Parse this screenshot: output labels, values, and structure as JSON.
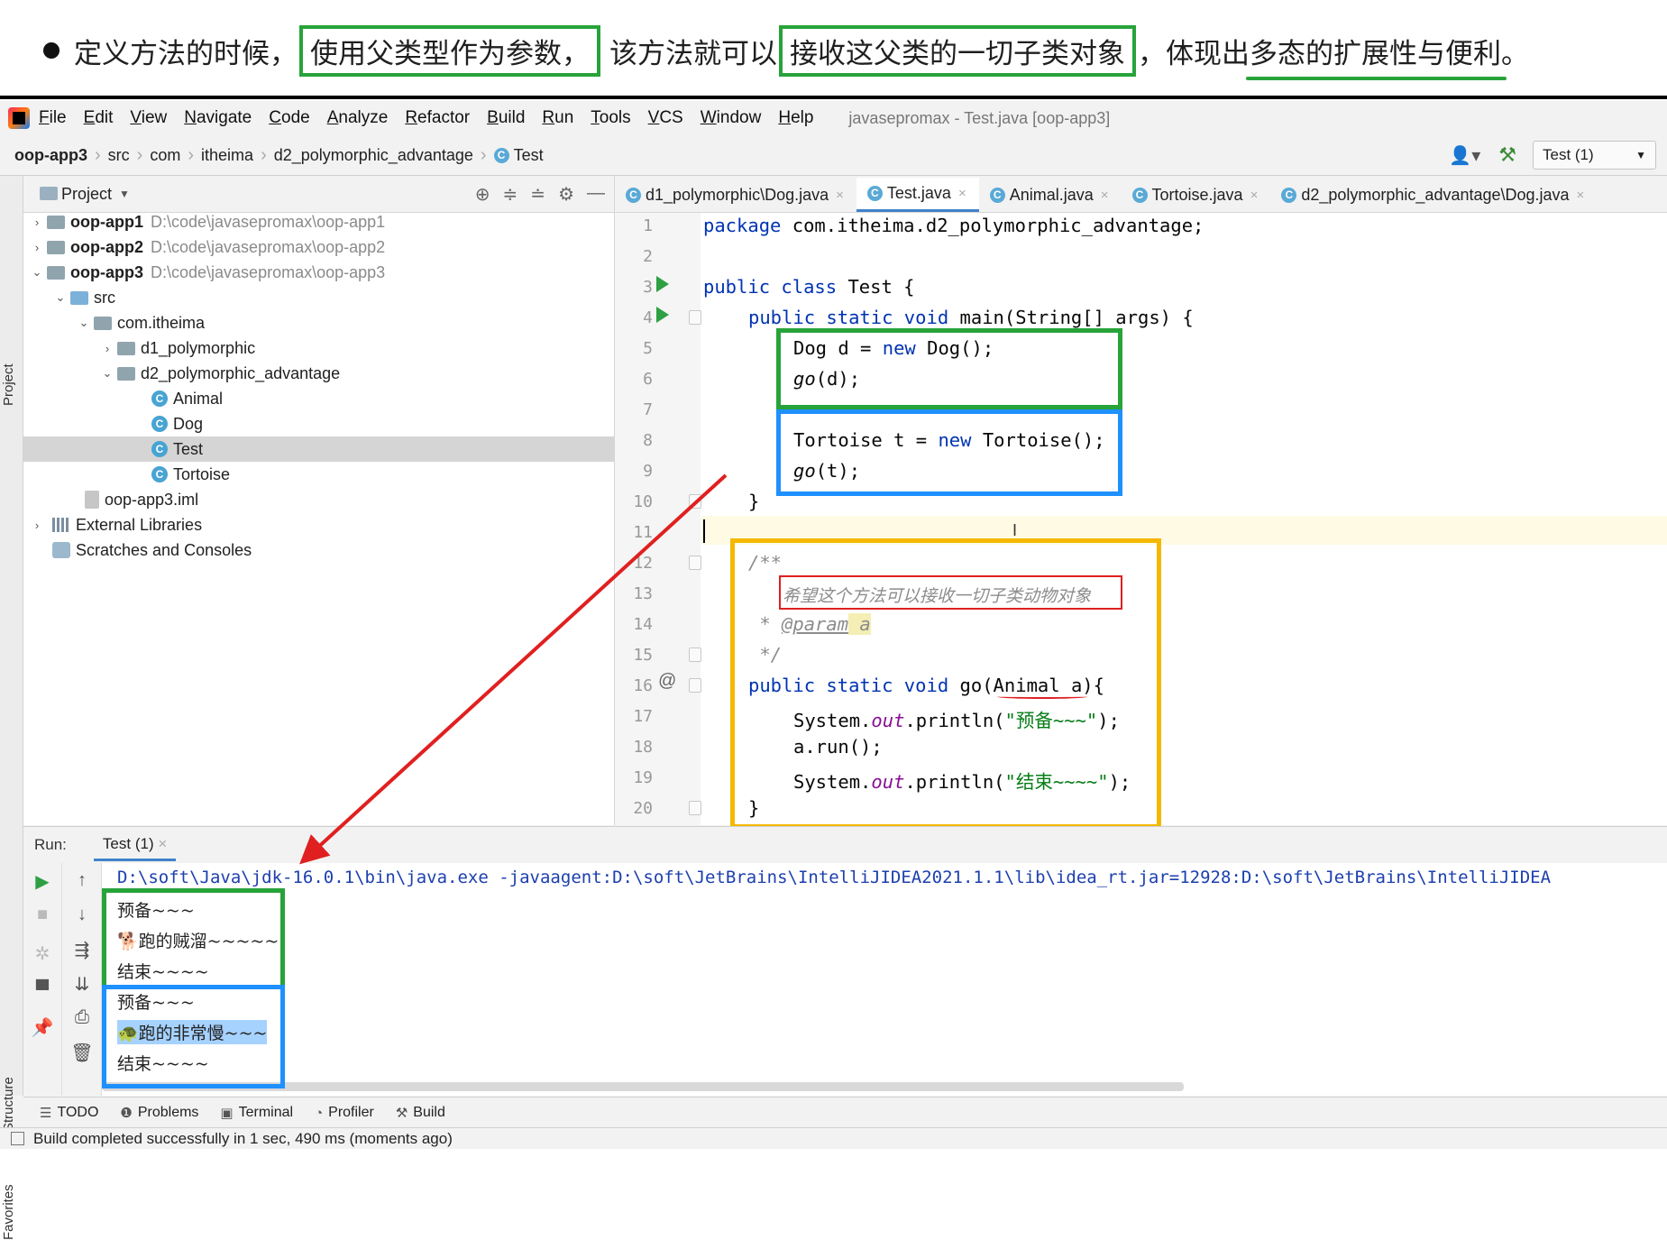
{
  "slide": {
    "heading_parts": [
      "定义方法的时候，",
      "使用父类型作为参数，",
      "该方法就可以",
      "接收这父类的一切子类对象",
      "，体现出",
      "多态的扩展性与便利",
      "。"
    ]
  },
  "menubar": {
    "items": [
      "File",
      "Edit",
      "View",
      "Navigate",
      "Code",
      "Analyze",
      "Refactor",
      "Build",
      "Run",
      "Tools",
      "VCS",
      "Window",
      "Help"
    ],
    "window_title": "javasepromax - Test.java [oop-app3]"
  },
  "navbar": {
    "breadcrumbs": [
      "oop-app3",
      "src",
      "com",
      "itheima",
      "d2_polymorphic_advantage",
      "Test"
    ],
    "run_config": "Test (1)"
  },
  "left_stripe": {
    "project_label": "Project",
    "structure_label": "Structure",
    "favorites_label": "Favorites"
  },
  "project_panel": {
    "title": "Project",
    "tree": [
      {
        "label": "oop-app1",
        "path": "D:\\code\\javasepromax\\oop-app1"
      },
      {
        "label": "oop-app2",
        "path": "D:\\code\\javasepromax\\oop-app2"
      },
      {
        "label": "oop-app3",
        "path": "D:\\code\\javasepromax\\oop-app3"
      },
      {
        "label": "src"
      },
      {
        "label": "com.itheima"
      },
      {
        "label": "d1_polymorphic"
      },
      {
        "label": "d2_polymorphic_advantage"
      },
      {
        "label": "Animal"
      },
      {
        "label": "Dog"
      },
      {
        "label": "Test"
      },
      {
        "label": "Tortoise"
      },
      {
        "label": "oop-app3.iml"
      },
      {
        "label": "External Libraries"
      },
      {
        "label": "Scratches and Consoles"
      }
    ]
  },
  "editor_tabs": [
    "d1_polymorphic\\Dog.java",
    "Test.java",
    "Animal.java",
    "Tortoise.java",
    "d2_polymorphic_advantage\\Dog.java"
  ],
  "code": {
    "line_numbers": [
      "1",
      "2",
      "3",
      "4",
      "5",
      "6",
      "7",
      "8",
      "9",
      "10",
      "11",
      "12",
      "13",
      "14",
      "15",
      "16",
      "17",
      "18",
      "19",
      "20"
    ],
    "l1_kw": "package",
    "l1_rest": " com.itheima.d2_polymorphic_advantage;",
    "l3_kw": "public class",
    "l3_rest": " Test {",
    "l4_kw": "public static void",
    "l4_rest": " main(String[] args) {",
    "l5_a": "Dog d = ",
    "l5_kw": "new",
    "l5_b": " Dog();",
    "l6_m": "go",
    "l6_b": "(d);",
    "l8_a": "Tortoise t = ",
    "l8_kw": "new",
    "l8_b": " Tortoise();",
    "l9_m": "go",
    "l9_b": "(t);",
    "l10": "}",
    "l12": "/**",
    "l13": "希望这个方法可以接收一切子类动物对象",
    "l14_a": " * ",
    "l14_tag": "@param",
    "l14_p": " a",
    "l15": " */",
    "l16_kw": "public static void",
    "l16_a": " go(",
    "l16_p": "Animal a",
    "l16_b": "){",
    "l17_a": "System.",
    "l17_f": "out",
    "l17_b": ".println(",
    "l17_s": "\"预备~~~\"",
    "l17_c": ");",
    "l18": "a.run();",
    "l19_a": "System.",
    "l19_f": "out",
    "l19_b": ".println(",
    "l19_s": "\"结束~~~~\"",
    "l19_c": ");",
    "l20": "}"
  },
  "run_panel": {
    "label": "Run:",
    "tab": "Test (1)",
    "command": "D:\\soft\\Java\\jdk-16.0.1\\bin\\java.exe -javaagent:D:\\soft\\JetBrains\\IntelliJIDEA2021.1.1\\lib\\idea_rt.jar=12928:D:\\soft\\JetBrains\\IntelliJIDEA",
    "output": [
      "预备~~~",
      "🐕跑的贼溜~~~~~",
      "结束~~~~",
      "预备~~~",
      "🐢跑的非常慢~~~",
      "结束~~~~"
    ]
  },
  "tool_tabs": [
    "TODO",
    "Problems",
    "Terminal",
    "Profiler",
    "Build"
  ],
  "status": "Build completed successfully in 1 sec, 490 ms (moments ago)",
  "colors": {
    "green_box": "#27a33a",
    "blue_box": "#1e90ff",
    "yellow_box": "#f5b800",
    "red_annotation": "#e02020"
  }
}
